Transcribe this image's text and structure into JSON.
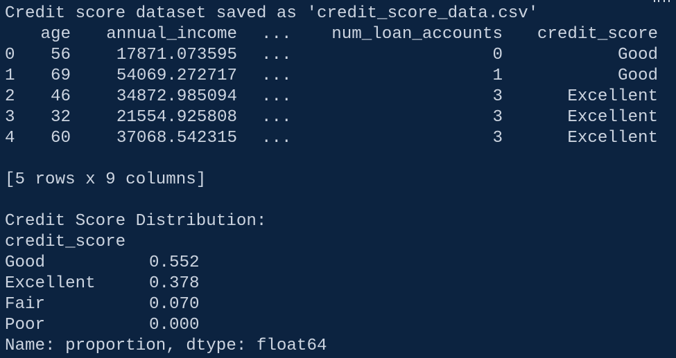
{
  "terminal": {
    "saved_message": "Credit score dataset saved as 'credit_score_data.csv'",
    "header": {
      "age": "age",
      "annual_income": "annual_income",
      "ellipsis": "...",
      "num_loan_accounts": "num_loan_accounts",
      "credit_score": "credit_score"
    },
    "rows": [
      {
        "index": "0",
        "age": "56",
        "annual_income": "17871.073595",
        "ellipsis": "...",
        "num_loan_accounts": "0",
        "credit_score": "Good"
      },
      {
        "index": "1",
        "age": "69",
        "annual_income": "54069.272717",
        "ellipsis": "...",
        "num_loan_accounts": "1",
        "credit_score": "Good"
      },
      {
        "index": "2",
        "age": "46",
        "annual_income": "34872.985094",
        "ellipsis": "...",
        "num_loan_accounts": "3",
        "credit_score": "Excellent"
      },
      {
        "index": "3",
        "age": "32",
        "annual_income": "21554.925808",
        "ellipsis": "...",
        "num_loan_accounts": "3",
        "credit_score": "Excellent"
      },
      {
        "index": "4",
        "age": "60",
        "annual_income": "37068.542315",
        "ellipsis": "...",
        "num_loan_accounts": "3",
        "credit_score": "Excellent"
      }
    ],
    "shape_text": "[5 rows x 9 columns]",
    "distribution_title": "Credit Score Distribution:",
    "distribution_index_name": "credit_score",
    "distribution": [
      {
        "label": "Good",
        "value": "0.552"
      },
      {
        "label": "Excellent",
        "value": "0.378"
      },
      {
        "label": "Fair",
        "value": "0.070"
      },
      {
        "label": "Poor",
        "value": "0.000"
      }
    ],
    "series_footer": "Name: proportion, dtype: float64"
  },
  "colors": {
    "background": "#0c2340",
    "text": "#ccd4e0"
  }
}
